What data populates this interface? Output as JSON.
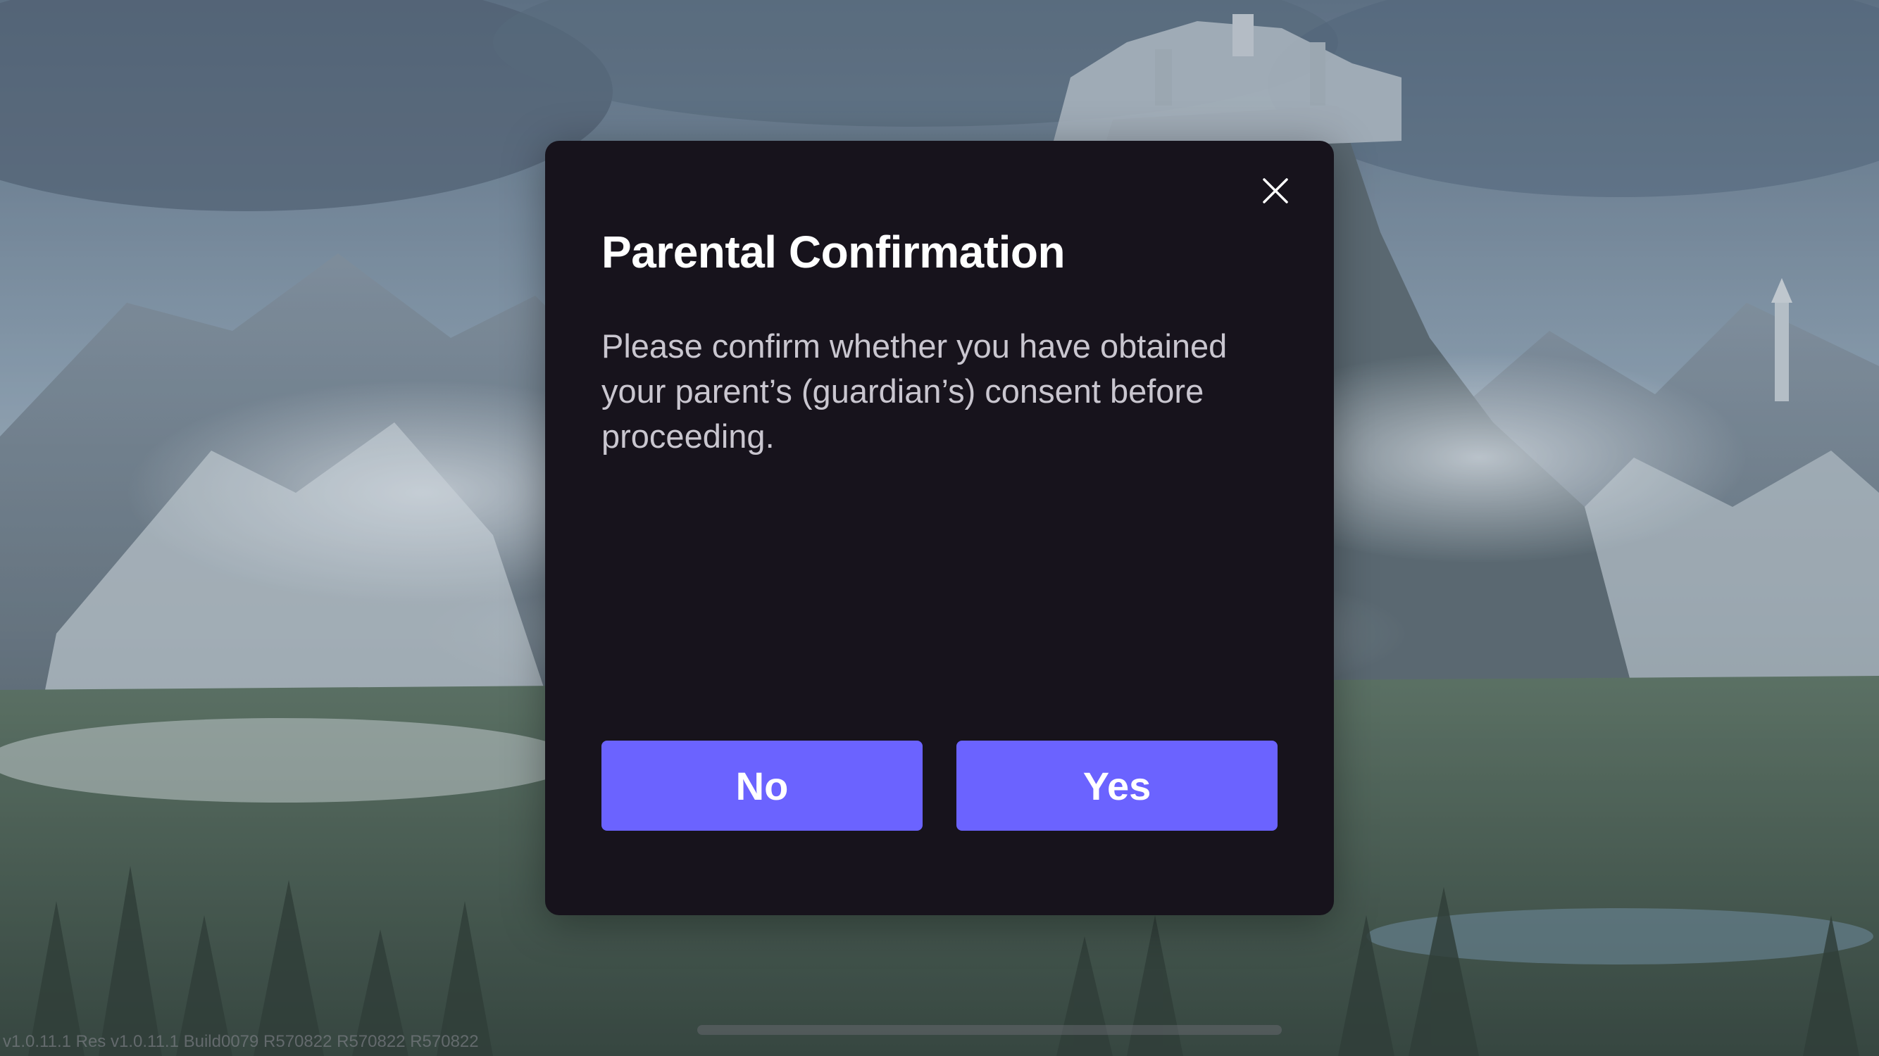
{
  "dialog": {
    "title": "Parental Confirmation",
    "message": "Please confirm whether you have obtained your parent’s (guardian’s) consent before proceeding.",
    "no_label": "No",
    "yes_label": "Yes",
    "close_icon": "close-icon"
  },
  "footer": {
    "version": "v1.0.11.1 Res v1.0.11.1 Build0079 R570822 R570822 R570822"
  },
  "colors": {
    "dialog_bg": "#17131c",
    "button_bg": "#6b63ff",
    "title_text": "#ffffff",
    "body_text": "#c9c6cf"
  }
}
